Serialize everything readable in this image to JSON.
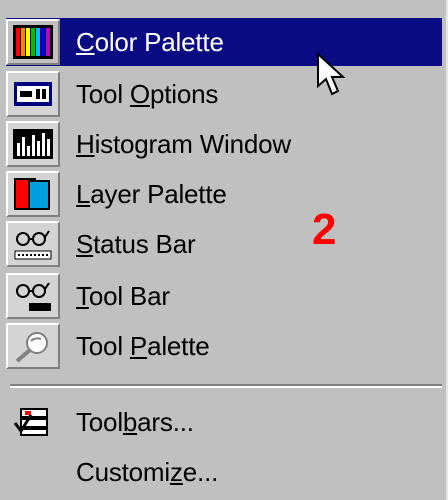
{
  "menu": {
    "items": [
      {
        "pre": "",
        "u": "C",
        "post": "olor Palette",
        "icon": "color-palette-icon",
        "checked": true,
        "highlighted": true
      },
      {
        "pre": "Tool ",
        "u": "O",
        "post": "ptions",
        "icon": "tool-options-icon",
        "checked": true
      },
      {
        "pre": "",
        "u": "H",
        "post": "istogram Window",
        "icon": "histogram-icon",
        "checked": true
      },
      {
        "pre": "",
        "u": "L",
        "post": "ayer Palette",
        "icon": "layer-palette-icon",
        "checked": true
      },
      {
        "pre": "",
        "u": "S",
        "post": "tatus Bar",
        "icon": "status-bar-icon",
        "checked": true
      },
      {
        "pre": "",
        "u": "T",
        "post": "ool Bar",
        "icon": "tool-bar-icon",
        "checked": true
      },
      {
        "pre": "Tool ",
        "u": "P",
        "post": "alette",
        "icon": "tool-palette-icon",
        "checked": true
      },
      {
        "pre": "Tool",
        "u": "b",
        "post": "ars...",
        "icon": "toolbars-icon",
        "checked": false
      },
      {
        "pre": "Customi",
        "u": "z",
        "post": "e...",
        "icon": "",
        "checked": false
      }
    ]
  },
  "annotation": {
    "number": "2",
    "color": "#ff0000"
  },
  "colors": {
    "menu_bg": "#c0c0c0",
    "highlight": "#0a0a82"
  }
}
